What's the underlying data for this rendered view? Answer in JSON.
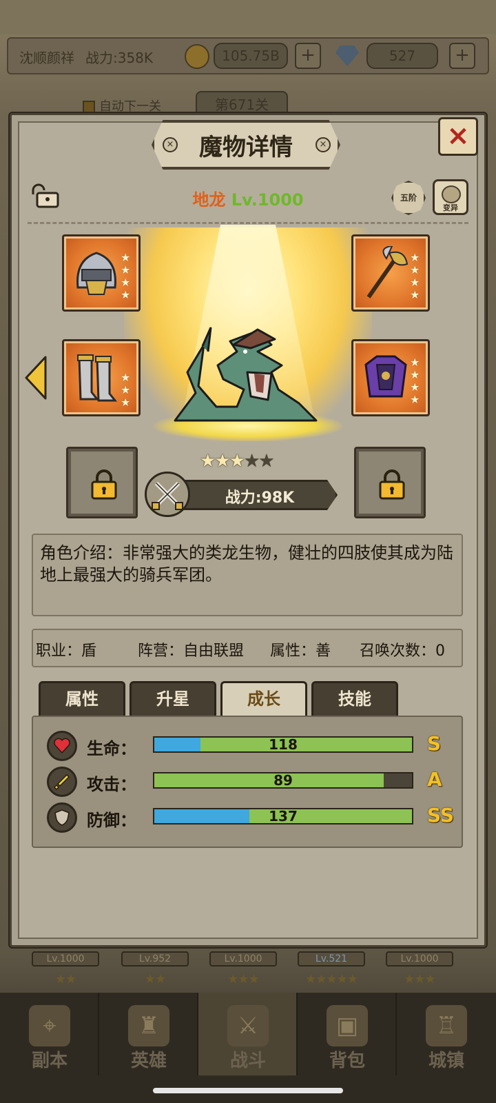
{
  "topbar": {
    "player_name": "沈顺颜祥",
    "power": "战力:358K",
    "gold": "105.75B",
    "gems": "527",
    "plus": "+"
  },
  "stage": {
    "auto_next": "自动下一关",
    "current": "第671关"
  },
  "modal": {
    "title": "魔物详情",
    "close": "×",
    "monster_name": "地龙",
    "monster_level": "Lv.1000",
    "rank": "五阶",
    "mutate": "变异",
    "stars_filled": 3,
    "stars_total": 5,
    "combat_power": "战力:98K",
    "equipment": [
      {
        "name": "helmet-icon",
        "stars": 4
      },
      {
        "name": "axe-icon",
        "stars": 4
      },
      {
        "name": "boots-icon",
        "stars": 3
      },
      {
        "name": "armor-icon",
        "stars": 4
      }
    ],
    "description": "角色介绍：非常强大的类龙生物，健壮的四肢使其成为陆地上最强大的骑兵军团。",
    "info": {
      "class": "职业：盾",
      "faction": "阵营：自由联盟",
      "alignment": "属性：善",
      "summons": "召唤次数：0"
    },
    "tabs": [
      "属性",
      "升星",
      "成长",
      "技能"
    ],
    "active_tab": 2,
    "stats": [
      {
        "label": "生命：",
        "value": "118",
        "grade": "S",
        "blue": 0.18,
        "green": 1.0,
        "icon": "heart-icon"
      },
      {
        "label": "攻击：",
        "value": "89",
        "grade": "A",
        "blue": 0.0,
        "green": 0.89,
        "icon": "sword-icon"
      },
      {
        "label": "防御：",
        "value": "137",
        "grade": "SS",
        "blue": 0.37,
        "green": 1.0,
        "icon": "shield-icon"
      }
    ]
  },
  "hero_strip": [
    {
      "level": "Lv.1000",
      "stars": "★★"
    },
    {
      "level": "Lv.952",
      "stars": "★★"
    },
    {
      "level": "Lv.1000",
      "stars": "★★★"
    },
    {
      "level": "Lv.521",
      "stars": "★★★★★"
    },
    {
      "level": "Lv.1000",
      "stars": "★★★"
    }
  ],
  "nav": [
    "副本",
    "英雄",
    "战斗",
    "背包",
    "城镇"
  ],
  "colors": {
    "accent_orange": "#e0601c",
    "level_green": "#6fb82b",
    "bar_blue": "#3ea8df",
    "bar_green": "#8dc255",
    "grade_gold": "#f3c024"
  }
}
